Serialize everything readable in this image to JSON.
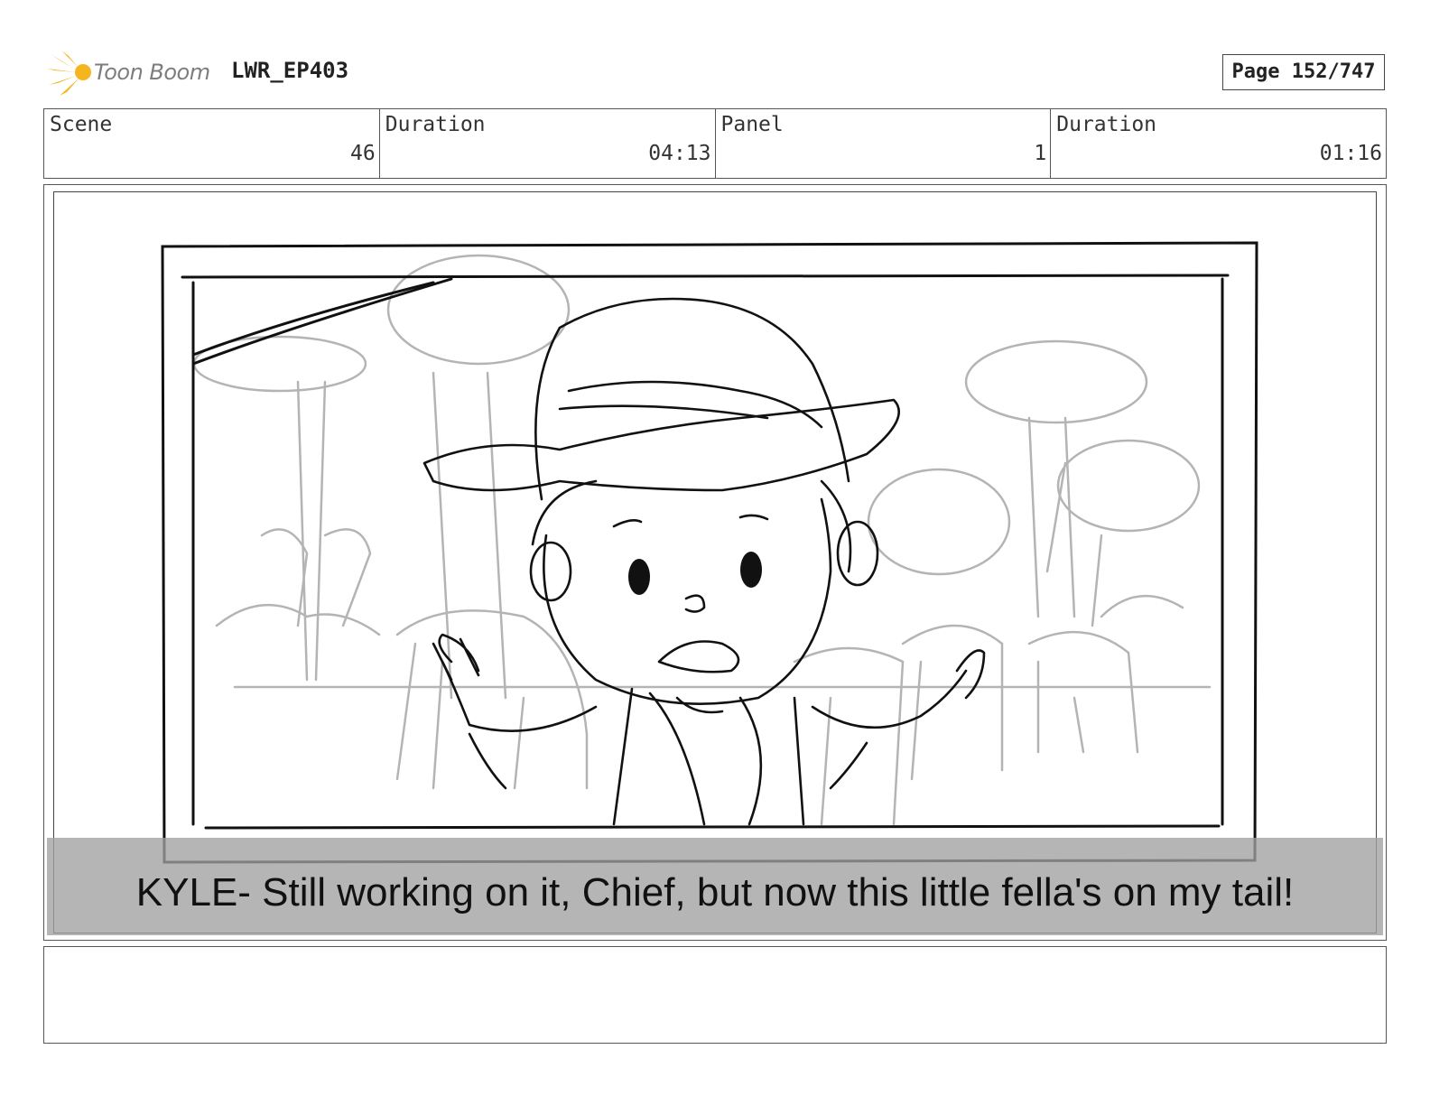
{
  "header": {
    "brand": "Toon Boom",
    "project": "LWR_EP403",
    "page": "Page 152/747"
  },
  "info": {
    "scene_label": "Scene",
    "scene_value": "46",
    "scene_duration_label": "Duration",
    "scene_duration_value": "04:13",
    "panel_label": "Panel",
    "panel_value": "1",
    "panel_duration_label": "Duration",
    "panel_duration_value": "01:16"
  },
  "panel": {
    "dialogue": "KYLE- Still working on it, Chief, but now this little fella's on my tail!"
  },
  "colors": {
    "logo_orange": "#f2b31c",
    "caption_band": "#a0a0a0"
  }
}
